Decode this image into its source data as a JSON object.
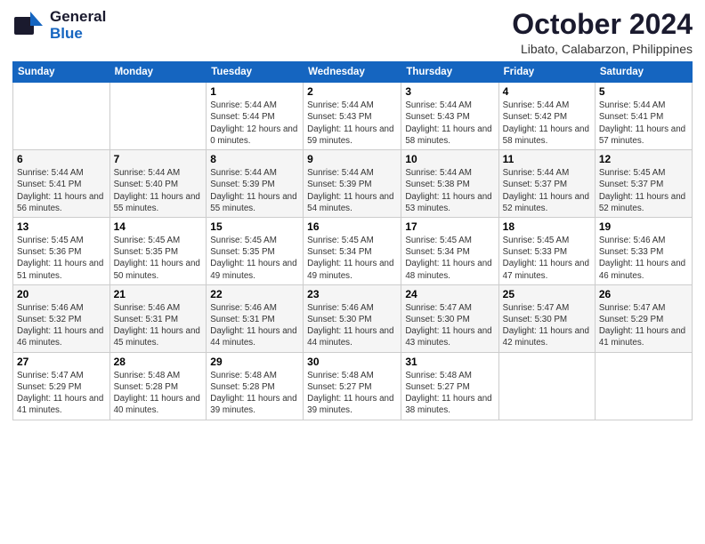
{
  "logo": {
    "general": "General",
    "blue": "Blue"
  },
  "title": {
    "month": "October 2024",
    "location": "Libato, Calabarzon, Philippines"
  },
  "headers": [
    "Sunday",
    "Monday",
    "Tuesday",
    "Wednesday",
    "Thursday",
    "Friday",
    "Saturday"
  ],
  "weeks": [
    [
      {
        "day": "",
        "sunrise": "",
        "sunset": "",
        "daylight": ""
      },
      {
        "day": "",
        "sunrise": "",
        "sunset": "",
        "daylight": ""
      },
      {
        "day": "1",
        "sunrise": "Sunrise: 5:44 AM",
        "sunset": "Sunset: 5:44 PM",
        "daylight": "Daylight: 12 hours and 0 minutes."
      },
      {
        "day": "2",
        "sunrise": "Sunrise: 5:44 AM",
        "sunset": "Sunset: 5:43 PM",
        "daylight": "Daylight: 11 hours and 59 minutes."
      },
      {
        "day": "3",
        "sunrise": "Sunrise: 5:44 AM",
        "sunset": "Sunset: 5:43 PM",
        "daylight": "Daylight: 11 hours and 58 minutes."
      },
      {
        "day": "4",
        "sunrise": "Sunrise: 5:44 AM",
        "sunset": "Sunset: 5:42 PM",
        "daylight": "Daylight: 11 hours and 58 minutes."
      },
      {
        "day": "5",
        "sunrise": "Sunrise: 5:44 AM",
        "sunset": "Sunset: 5:41 PM",
        "daylight": "Daylight: 11 hours and 57 minutes."
      }
    ],
    [
      {
        "day": "6",
        "sunrise": "Sunrise: 5:44 AM",
        "sunset": "Sunset: 5:41 PM",
        "daylight": "Daylight: 11 hours and 56 minutes."
      },
      {
        "day": "7",
        "sunrise": "Sunrise: 5:44 AM",
        "sunset": "Sunset: 5:40 PM",
        "daylight": "Daylight: 11 hours and 55 minutes."
      },
      {
        "day": "8",
        "sunrise": "Sunrise: 5:44 AM",
        "sunset": "Sunset: 5:39 PM",
        "daylight": "Daylight: 11 hours and 55 minutes."
      },
      {
        "day": "9",
        "sunrise": "Sunrise: 5:44 AM",
        "sunset": "Sunset: 5:39 PM",
        "daylight": "Daylight: 11 hours and 54 minutes."
      },
      {
        "day": "10",
        "sunrise": "Sunrise: 5:44 AM",
        "sunset": "Sunset: 5:38 PM",
        "daylight": "Daylight: 11 hours and 53 minutes."
      },
      {
        "day": "11",
        "sunrise": "Sunrise: 5:44 AM",
        "sunset": "Sunset: 5:37 PM",
        "daylight": "Daylight: 11 hours and 52 minutes."
      },
      {
        "day": "12",
        "sunrise": "Sunrise: 5:45 AM",
        "sunset": "Sunset: 5:37 PM",
        "daylight": "Daylight: 11 hours and 52 minutes."
      }
    ],
    [
      {
        "day": "13",
        "sunrise": "Sunrise: 5:45 AM",
        "sunset": "Sunset: 5:36 PM",
        "daylight": "Daylight: 11 hours and 51 minutes."
      },
      {
        "day": "14",
        "sunrise": "Sunrise: 5:45 AM",
        "sunset": "Sunset: 5:35 PM",
        "daylight": "Daylight: 11 hours and 50 minutes."
      },
      {
        "day": "15",
        "sunrise": "Sunrise: 5:45 AM",
        "sunset": "Sunset: 5:35 PM",
        "daylight": "Daylight: 11 hours and 49 minutes."
      },
      {
        "day": "16",
        "sunrise": "Sunrise: 5:45 AM",
        "sunset": "Sunset: 5:34 PM",
        "daylight": "Daylight: 11 hours and 49 minutes."
      },
      {
        "day": "17",
        "sunrise": "Sunrise: 5:45 AM",
        "sunset": "Sunset: 5:34 PM",
        "daylight": "Daylight: 11 hours and 48 minutes."
      },
      {
        "day": "18",
        "sunrise": "Sunrise: 5:45 AM",
        "sunset": "Sunset: 5:33 PM",
        "daylight": "Daylight: 11 hours and 47 minutes."
      },
      {
        "day": "19",
        "sunrise": "Sunrise: 5:46 AM",
        "sunset": "Sunset: 5:33 PM",
        "daylight": "Daylight: 11 hours and 46 minutes."
      }
    ],
    [
      {
        "day": "20",
        "sunrise": "Sunrise: 5:46 AM",
        "sunset": "Sunset: 5:32 PM",
        "daylight": "Daylight: 11 hours and 46 minutes."
      },
      {
        "day": "21",
        "sunrise": "Sunrise: 5:46 AM",
        "sunset": "Sunset: 5:31 PM",
        "daylight": "Daylight: 11 hours and 45 minutes."
      },
      {
        "day": "22",
        "sunrise": "Sunrise: 5:46 AM",
        "sunset": "Sunset: 5:31 PM",
        "daylight": "Daylight: 11 hours and 44 minutes."
      },
      {
        "day": "23",
        "sunrise": "Sunrise: 5:46 AM",
        "sunset": "Sunset: 5:30 PM",
        "daylight": "Daylight: 11 hours and 44 minutes."
      },
      {
        "day": "24",
        "sunrise": "Sunrise: 5:47 AM",
        "sunset": "Sunset: 5:30 PM",
        "daylight": "Daylight: 11 hours and 43 minutes."
      },
      {
        "day": "25",
        "sunrise": "Sunrise: 5:47 AM",
        "sunset": "Sunset: 5:30 PM",
        "daylight": "Daylight: 11 hours and 42 minutes."
      },
      {
        "day": "26",
        "sunrise": "Sunrise: 5:47 AM",
        "sunset": "Sunset: 5:29 PM",
        "daylight": "Daylight: 11 hours and 41 minutes."
      }
    ],
    [
      {
        "day": "27",
        "sunrise": "Sunrise: 5:47 AM",
        "sunset": "Sunset: 5:29 PM",
        "daylight": "Daylight: 11 hours and 41 minutes."
      },
      {
        "day": "28",
        "sunrise": "Sunrise: 5:48 AM",
        "sunset": "Sunset: 5:28 PM",
        "daylight": "Daylight: 11 hours and 40 minutes."
      },
      {
        "day": "29",
        "sunrise": "Sunrise: 5:48 AM",
        "sunset": "Sunset: 5:28 PM",
        "daylight": "Daylight: 11 hours and 39 minutes."
      },
      {
        "day": "30",
        "sunrise": "Sunrise: 5:48 AM",
        "sunset": "Sunset: 5:27 PM",
        "daylight": "Daylight: 11 hours and 39 minutes."
      },
      {
        "day": "31",
        "sunrise": "Sunrise: 5:48 AM",
        "sunset": "Sunset: 5:27 PM",
        "daylight": "Daylight: 11 hours and 38 minutes."
      },
      {
        "day": "",
        "sunrise": "",
        "sunset": "",
        "daylight": ""
      },
      {
        "day": "",
        "sunrise": "",
        "sunset": "",
        "daylight": ""
      }
    ]
  ]
}
